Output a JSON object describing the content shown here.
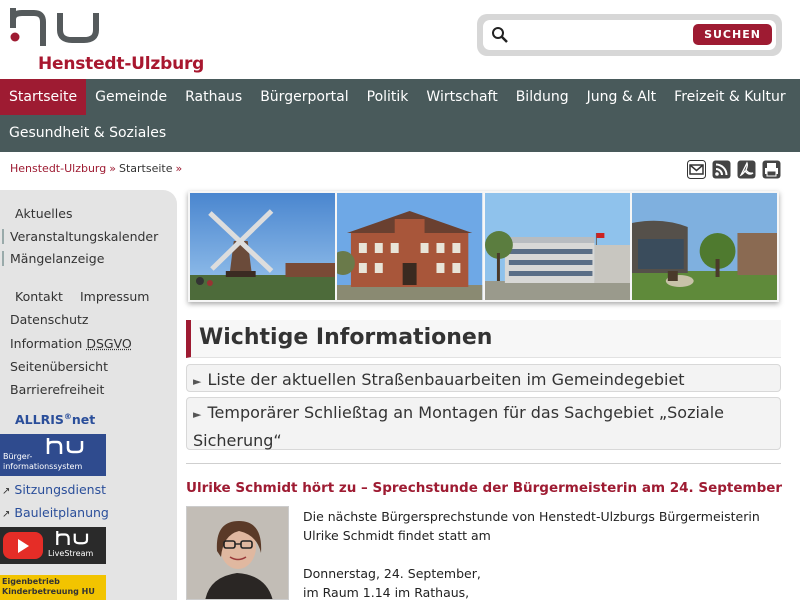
{
  "brand": {
    "name": "Henstedt-Ulzburg",
    "accent": "#9e1b32",
    "nav_bg": "#495a5b"
  },
  "search": {
    "placeholder": "",
    "button_label": "SUCHEN"
  },
  "nav": {
    "row1": [
      "Startseite",
      "Gemeinde",
      "Rathaus",
      "Bürgerportal",
      "Politik",
      "Wirtschaft",
      "Bildung",
      "Jung & Alt",
      "Freizeit & Kultur"
    ],
    "row2": [
      "Gesundheit & Soziales"
    ],
    "active": "Startseite"
  },
  "breadcrumb": {
    "items": [
      "Henstedt-Ulzburg",
      "Startseite"
    ],
    "separator": "»"
  },
  "tools": [
    "mail-icon",
    "rss-icon",
    "pdf-icon",
    "print-icon"
  ],
  "sidebar": {
    "links": [
      "Aktuelles",
      "Veranstaltungskalender",
      "Mängelanzeige",
      "Kontakt",
      "Impressum",
      "Datenschutz",
      "Information",
      "DSGVO",
      "Seitenübersicht",
      "Barrierefreiheit"
    ],
    "allris": {
      "text": "ALLRIS",
      "sup": "®",
      "suffix": "net"
    },
    "bis_banner": {
      "logo": "hu",
      "line1": "Bürger-",
      "line2": "informationssystem"
    },
    "ext_links": [
      "Sitzungsdienst",
      "Bauleitplanung"
    ],
    "live_banner": {
      "logo": "hu",
      "label": "LiveStream"
    },
    "kita_banner": {
      "line1": "Eigenbetrieb",
      "line2": "Kinderbetreuung HU"
    }
  },
  "main": {
    "section_title": "Wichtige Informationen",
    "accordion": [
      "Liste der aktuellen Straßenbauarbeiten im Gemeindegebiet",
      "Temporärer Schließtag an Montagen für das Sachgebiet „Soziale Sicherung“"
    ],
    "news": {
      "title": "Ulrike Schmidt hört zu – Sprechstunde der Bürgermeisterin am 24. September",
      "p1": "Die nächste Bürgersprechstunde von Henstedt-Ulzburgs Bürgermeisterin Ulrike Schmidt findet statt am",
      "p2": "Donnerstag, 24. September,",
      "p3": "im Raum 1.14 im Rathaus,"
    }
  }
}
